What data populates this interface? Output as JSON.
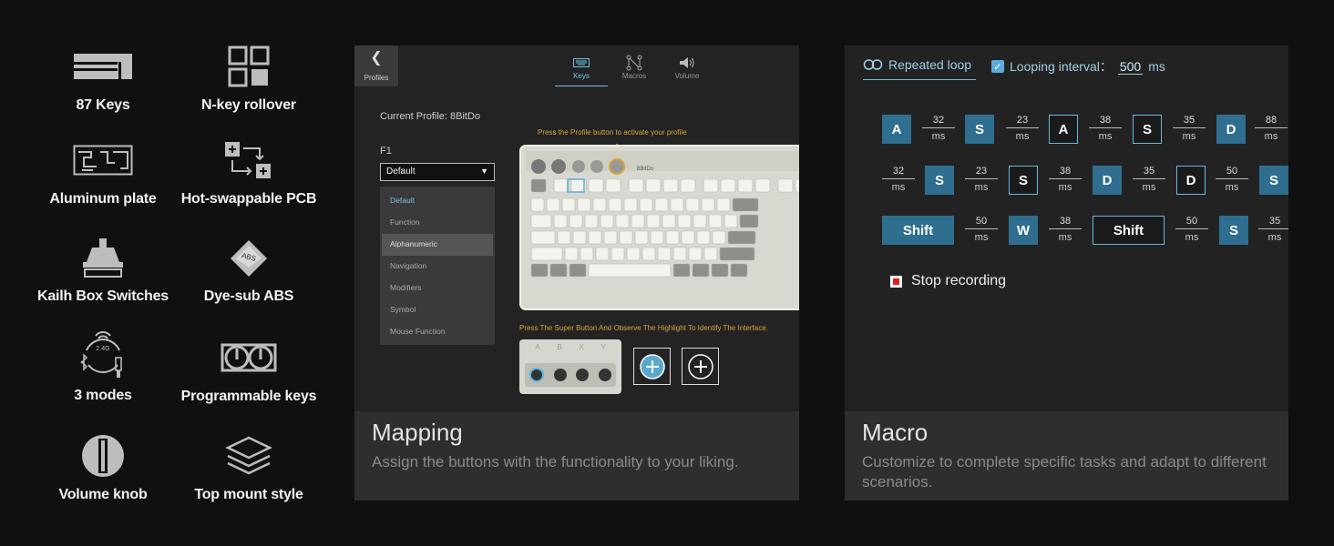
{
  "features": [
    {
      "label": "87 Keys",
      "icon": "keyboard-icon"
    },
    {
      "label": "N-key rollover",
      "icon": "grid-icon"
    },
    {
      "label": "Aluminum plate",
      "icon": "plate-icon"
    },
    {
      "label": "Hot-swappable PCB",
      "icon": "swap-icon"
    },
    {
      "label": "Kailh Box Switches",
      "icon": "switch-icon"
    },
    {
      "label": "Dye-sub ABS",
      "icon": "keycap-icon",
      "badge": "ABS"
    },
    {
      "label": "3 modes",
      "icon": "connection-modes-icon",
      "badge": "2.4G"
    },
    {
      "label": "Programmable keys",
      "icon": "gamepad-buttons-icon"
    },
    {
      "label": "Volume knob",
      "icon": "knob-icon"
    },
    {
      "label": "Top mount style",
      "icon": "layers-icon"
    }
  ],
  "mapping": {
    "back_label": "Profiles",
    "tabs": [
      {
        "label": "Keys",
        "active": true
      },
      {
        "label": "Macros",
        "active": false
      },
      {
        "label": "Volume",
        "active": false
      }
    ],
    "current_profile": "Current Profile: 8BitDo",
    "f1_label": "F1",
    "dropdown_value": "Default",
    "dropdown_options": [
      "Default",
      "Function",
      "Alphanumeric",
      "Navigation",
      "Modifiers",
      "Symbol",
      "Mouse Function"
    ],
    "profile_hint": "Press the Profile button to activate your profile",
    "super_hint": "Press The Super Button And Observe The Highlight To Identify The Interface.",
    "pad_letters": [
      "A",
      "B",
      "X",
      "Y"
    ],
    "caption_title": "Mapping",
    "caption_desc": "Assign the buttons with the functionality to your liking."
  },
  "macro": {
    "tab_repeat": "Repeated loop",
    "tab_interval": "Looping interval：",
    "interval_value": "500",
    "interval_unit": "ms",
    "unit": "ms",
    "keys": [
      "A",
      "S",
      "A",
      "S",
      "D",
      "S",
      "S",
      "D",
      "D",
      "S",
      "Shift",
      "W",
      "Shift",
      "S"
    ],
    "delays": [
      "32",
      "23",
      "38",
      "35",
      "88",
      "32",
      "23",
      "38",
      "35",
      "50",
      "50",
      "38",
      "50",
      "35"
    ],
    "stop_label": "Stop recording",
    "caption_title": "Macro",
    "caption_desc": "Customize to complete specific tasks and adapt to different scenarios."
  }
}
